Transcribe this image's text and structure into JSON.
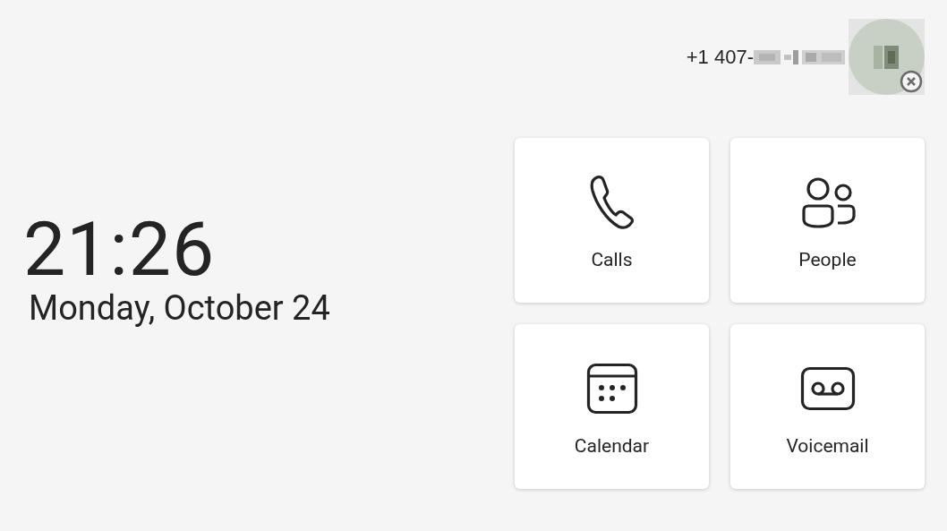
{
  "header": {
    "phone_number": "+1 407-",
    "avatar": {
      "offline": true
    }
  },
  "clock": {
    "time": "21:26",
    "date": "Monday, October 24"
  },
  "tiles": [
    {
      "kind": "calls",
      "label": "Calls"
    },
    {
      "kind": "people",
      "label": "People"
    },
    {
      "kind": "calendar",
      "label": "Calendar"
    },
    {
      "kind": "voicemail",
      "label": "Voicemail"
    }
  ]
}
